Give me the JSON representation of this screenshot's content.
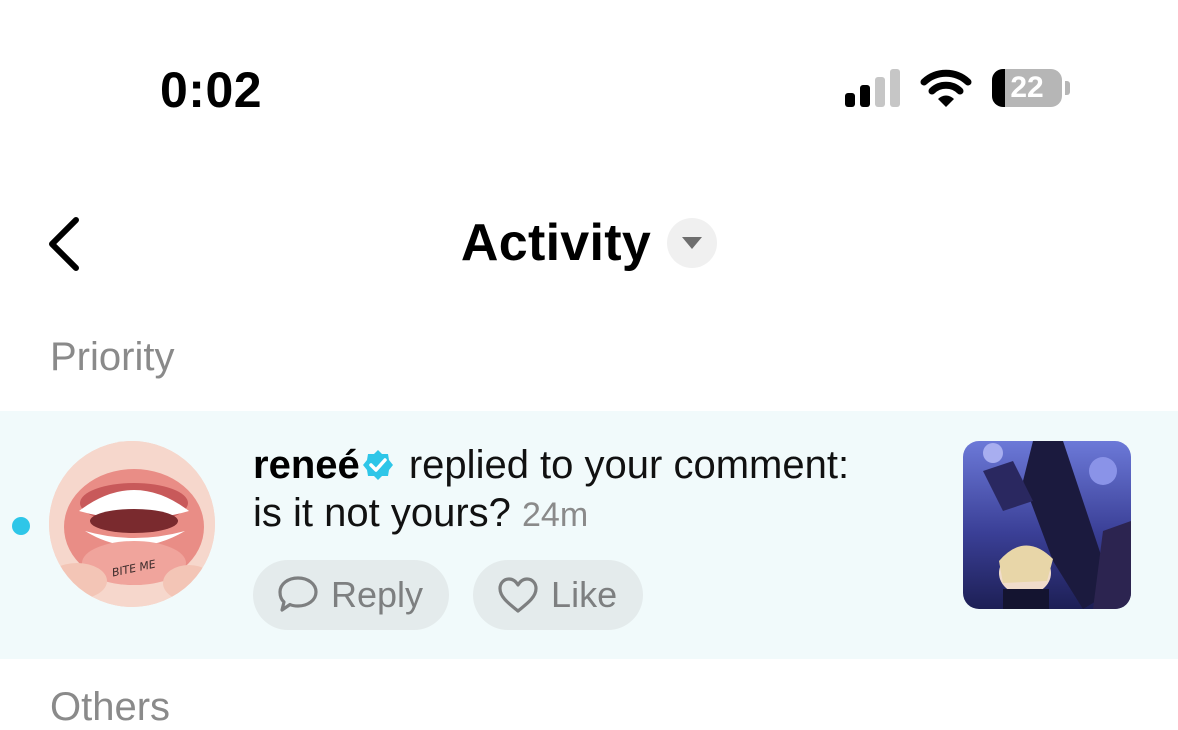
{
  "status_bar": {
    "time": "0:02",
    "battery": "22"
  },
  "nav": {
    "title": "Activity"
  },
  "sections": {
    "priority": "Priority",
    "others": "Others"
  },
  "notification": {
    "username": "reneé",
    "action_text": " replied to your comment:",
    "comment": "is it not yours?",
    "time_ago": "24m",
    "avatar_tattoo_text": "BITE ME",
    "reply_label": "Reply",
    "like_label": "Like"
  },
  "colors": {
    "unread_dot": "#2ec6e8",
    "verified_badge": "#2ec6e8",
    "row_highlight": "#f1fafb",
    "pill_background": "#e4ebec"
  },
  "icons": [
    "back-chevron-icon",
    "dropdown-triangle-icon",
    "verified-badge-icon",
    "comment-bubble-icon",
    "heart-icon",
    "wifi-icon",
    "signal-icon",
    "battery-icon"
  ]
}
